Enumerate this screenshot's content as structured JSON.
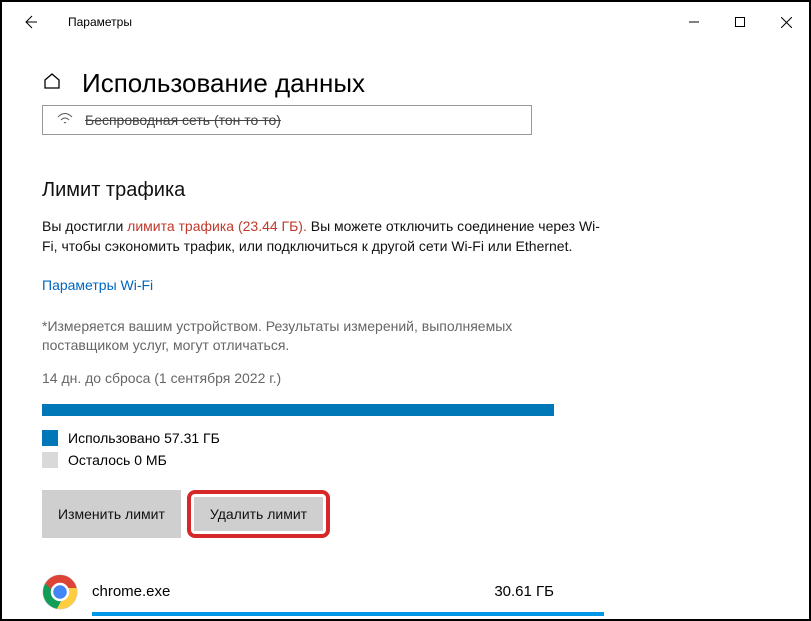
{
  "window": {
    "title": "Параметры"
  },
  "page": {
    "title": "Использование данных",
    "network_strike": "Беспроводная сеть (тон то то)"
  },
  "limit": {
    "heading": "Лимит трафика",
    "reached_prefix": "Вы достигли",
    "reached_value": "лимита трафика (23.44 ГБ).",
    "reached_suffix": "Вы можете отключить соединение через Wi-Fi, чтобы сэкономить трафик, или подключиться к другой сети Wi-Fi или Ethernet.",
    "wifi_link": "Параметры Wi-Fi",
    "footnote": "*Измеряется вашим устройством. Результаты измерений, выполняемых поставщиком услуг, могут отличаться.",
    "reset": "14 дн. до сброса (1 сентября 2022 г.)",
    "used": "Использовано 57.31 ГБ",
    "remaining": "Осталось 0 МБ",
    "change_btn": "Изменить лимит",
    "remove_btn": "Удалить лимит"
  },
  "apps": {
    "chrome": {
      "name": "chrome.exe",
      "size": "30.61 ГБ"
    }
  }
}
